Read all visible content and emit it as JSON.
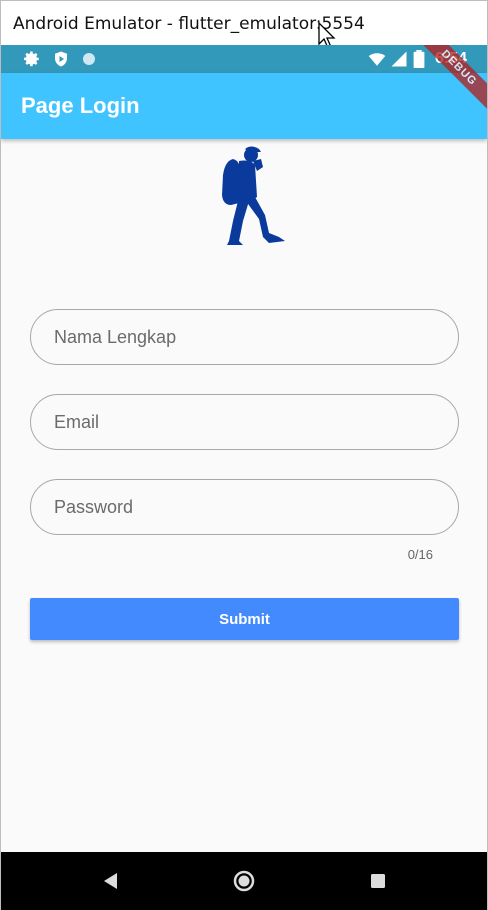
{
  "window": {
    "title": "Android Emulator - flutter_emulator:5554"
  },
  "status_bar": {
    "time": "6:54",
    "left_icons": [
      "settings-icon",
      "shield-play-icon",
      "circle-icon"
    ],
    "right_icons": [
      "wifi-icon",
      "signal-icon",
      "battery-icon"
    ]
  },
  "app_bar": {
    "title": "Page Login",
    "color": "#40c4ff"
  },
  "debug_banner": {
    "label": "DEBUG"
  },
  "form": {
    "name_placeholder": "Nama Lengkap",
    "email_placeholder": "Email",
    "password_placeholder": "Password",
    "password_counter": "0/16",
    "submit_label": "Submit",
    "submit_color": "#448aff"
  },
  "nav_bar": {
    "buttons": [
      "back-icon",
      "home-icon",
      "recents-icon"
    ]
  }
}
